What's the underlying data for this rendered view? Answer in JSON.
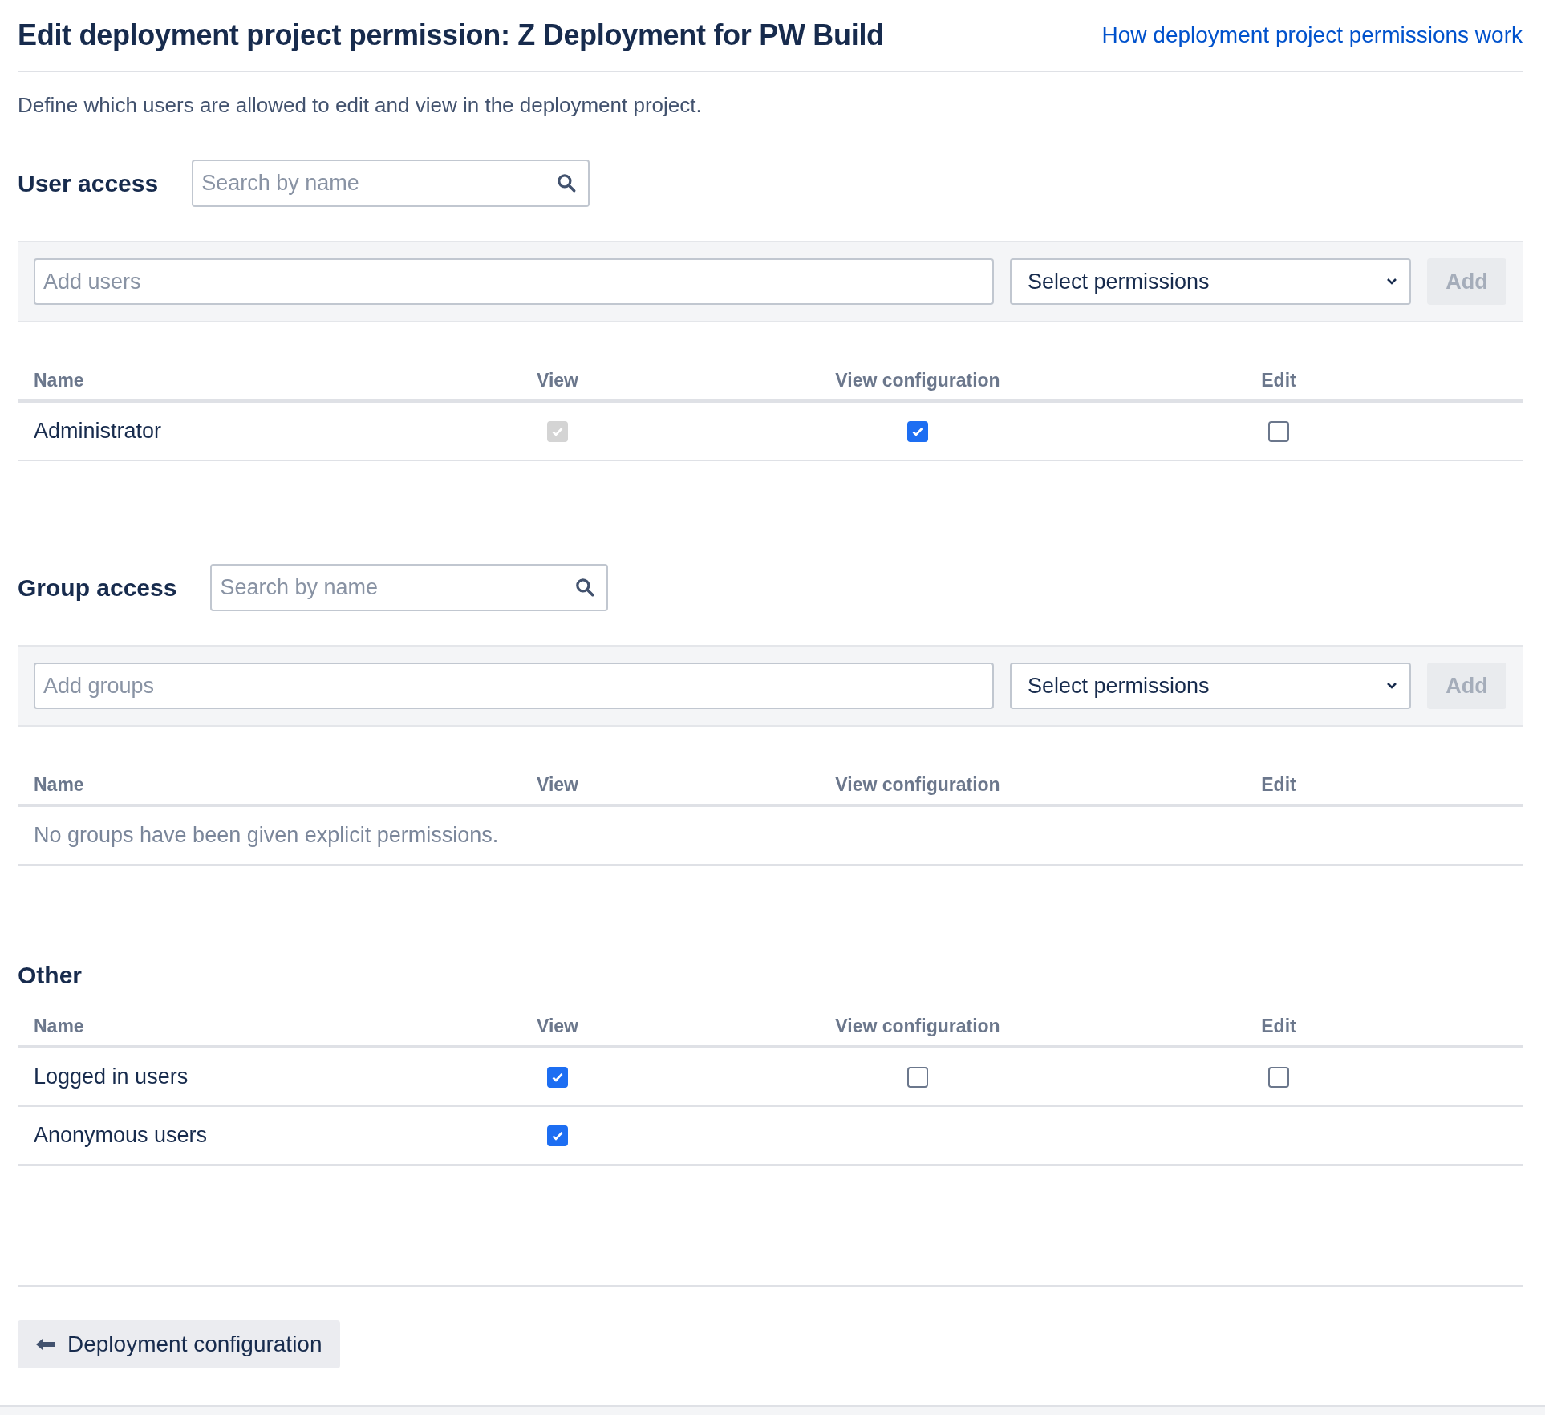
{
  "header": {
    "title": "Edit deployment project permission: Z Deployment for PW Build",
    "help_link": "How deployment project permissions work"
  },
  "description": "Define which users are allowed to edit and view in the deployment project.",
  "sections": [
    {
      "title": "User access",
      "search": {
        "placeholder": "Search by name"
      },
      "add_field": {
        "placeholder": "Add users"
      },
      "permissions_select": "Select permissions",
      "add_button": {
        "label": "Add",
        "disabled": true
      },
      "columns": [
        "Name",
        "View",
        "View configuration",
        "Edit"
      ],
      "rows": [
        {
          "name": "Administrator",
          "permissions": [
            {
              "checked": true,
              "disabled": true
            },
            {
              "checked": true,
              "disabled": false
            },
            {
              "checked": false,
              "disabled": false
            }
          ]
        }
      ]
    },
    {
      "title": "Group access",
      "search": {
        "placeholder": "Search by name"
      },
      "add_field": {
        "placeholder": "Add groups"
      },
      "permissions_select": "Select permissions",
      "add_button": {
        "label": "Add",
        "disabled": true
      },
      "columns": [
        "Name",
        "View",
        "View configuration",
        "Edit"
      ],
      "empty_message": "No groups have been given explicit permissions."
    },
    {
      "title": "Other",
      "columns": [
        "Name",
        "View",
        "View configuration",
        "Edit"
      ],
      "rows": [
        {
          "name": "Logged in users",
          "permissions": [
            {
              "checked": true,
              "disabled": false
            },
            {
              "checked": false,
              "disabled": false
            },
            {
              "checked": false,
              "disabled": false
            }
          ]
        },
        {
          "name": "Anonymous users",
          "permissions": [
            {
              "checked": true,
              "disabled": false
            }
          ]
        }
      ]
    }
  ],
  "back_button": "Deployment configuration"
}
